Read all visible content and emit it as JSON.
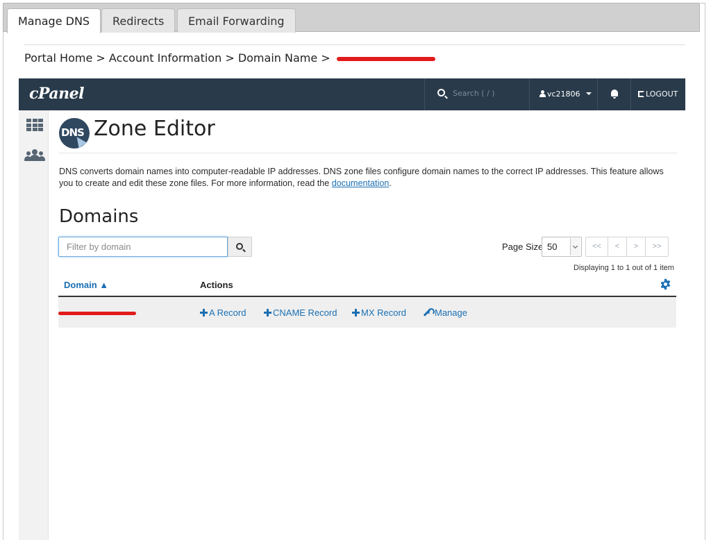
{
  "tabs": [
    {
      "label": "Manage DNS",
      "active": true
    },
    {
      "label": "Redirects",
      "active": false
    },
    {
      "label": "Email Forwarding",
      "active": false
    }
  ],
  "breadcrumb": {
    "items": [
      "Portal Home",
      "Account Information",
      "Domain Name"
    ],
    "separator": ">"
  },
  "header": {
    "logo": "cPanel",
    "search_placeholder": "Search ( / )",
    "username": "vc21806",
    "logout_label": "LOGOUT",
    "bg_color": "#293a4a"
  },
  "sidebar": {
    "icons": [
      "grid-icon",
      "users-icon"
    ]
  },
  "page": {
    "logo_text": "DNS",
    "title": "Zone Editor",
    "description_part1": "DNS converts domain names into computer-readable IP addresses. DNS zone files configure domain names to the correct IP addresses. This feature allows you to create and edit these zone files. For more information, read the ",
    "description_link": "documentation",
    "description_part2": ".",
    "section_title": "Domains"
  },
  "filter": {
    "placeholder": "Filter by domain",
    "value": ""
  },
  "pagination": {
    "page_size_label": "Page Size",
    "page_size_value": "50",
    "buttons": [
      "<<",
      "<",
      ">",
      ">>"
    ],
    "displaying_text": "Displaying 1 to 1 out of 1 item"
  },
  "table": {
    "columns": {
      "domain": "Domain ▲",
      "actions": "Actions"
    },
    "rows": [
      {
        "domain_redacted": true,
        "actions": [
          "A Record",
          "CNAME Record",
          "MX Record",
          "Manage"
        ]
      }
    ]
  },
  "colors": {
    "link": "#1a6fb3",
    "redaction": "#e11b1b"
  }
}
